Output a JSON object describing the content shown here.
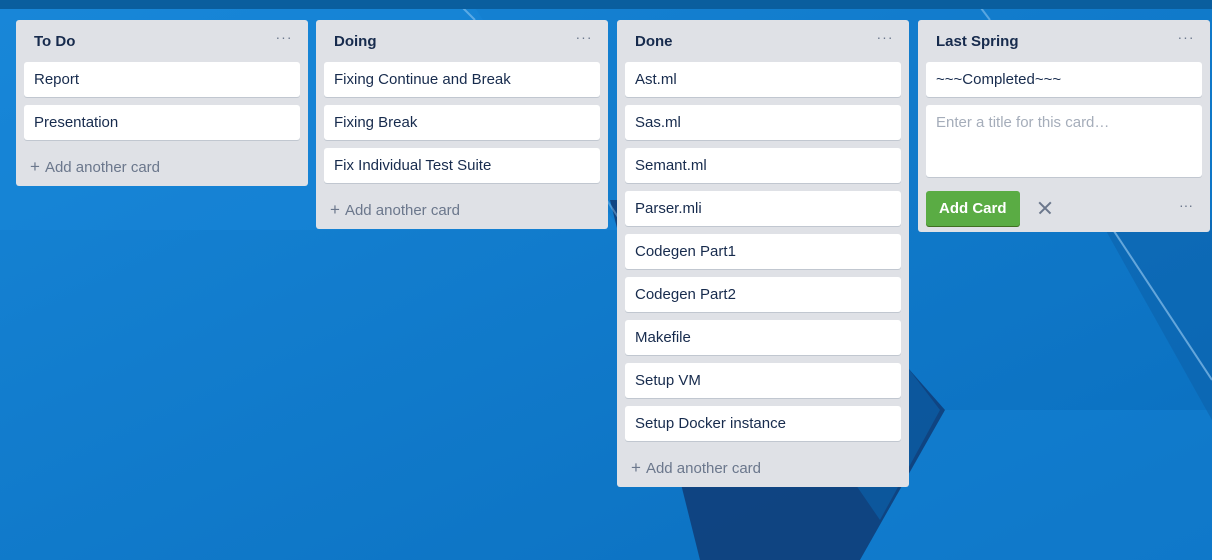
{
  "lists": [
    {
      "title": "To Do",
      "cards": [
        "Report",
        "Presentation"
      ],
      "add_label": "Add another card"
    },
    {
      "title": "Doing",
      "cards": [
        "Fixing Continue and Break",
        "Fixing Break",
        "Fix Individual Test Suite"
      ],
      "add_label": "Add another card"
    },
    {
      "title": "Done",
      "cards": [
        "Ast.ml",
        "Sas.ml",
        "Semant.ml",
        "Parser.mli",
        "Codegen Part1",
        "Codegen Part2",
        "Makefile",
        "Setup VM",
        "Setup Docker instance"
      ],
      "add_label": "Add another card"
    },
    {
      "title": "Last Spring",
      "cards": [
        "~~~Completed~~~"
      ],
      "composer_placeholder": "Enter a title for this card…",
      "add_button_label": "Add Card"
    }
  ],
  "icons": {
    "list_menu": "ellipsis-icon",
    "plus": "plus-icon",
    "close": "close-icon"
  },
  "colors": {
    "background": "#0b79c9",
    "list_bg": "#dfe1e6",
    "add_button": "#5aac44"
  }
}
